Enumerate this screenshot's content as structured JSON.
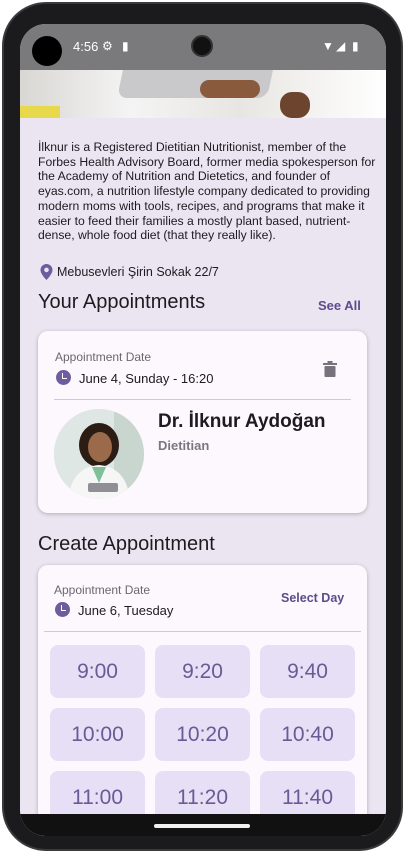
{
  "status": {
    "time": "4:56"
  },
  "bio": "İlknur is a Registered Dietitian Nutritionist, member of the Forbes Health Advisory Board, former media spokesperson for the Academy of Nutrition and Dietetics, and founder of eyas.com, a nutrition lifestyle company dedicated to providing modern moms with tools, recipes, and programs that make it easier to feed their families a mostly plant based, nutrient-dense, whole food diet (that they really like).",
  "address": "Mebusevleri Şirin Sokak 22/7",
  "appointments": {
    "title": "Your Appointments",
    "see_all": "See All",
    "date_label": "Appointment Date",
    "date_value": "June 4, Sunday - 16:20",
    "doctor_name": "Dr. İlknur Aydoğan",
    "doctor_role": "Dietitian"
  },
  "create": {
    "title": "Create Appointment",
    "date_label": "Appointment Date",
    "date_value": "June 6, Tuesday",
    "select_day": "Select Day",
    "slots": [
      "9:00",
      "9:20",
      "9:40",
      "10:00",
      "10:20",
      "10:40",
      "11:00",
      "11:20",
      "11:40"
    ]
  },
  "colors": {
    "accent": "#6f5c9d",
    "slot_bg": "#e7dff5",
    "screen_bg": "#ebe5f1"
  }
}
